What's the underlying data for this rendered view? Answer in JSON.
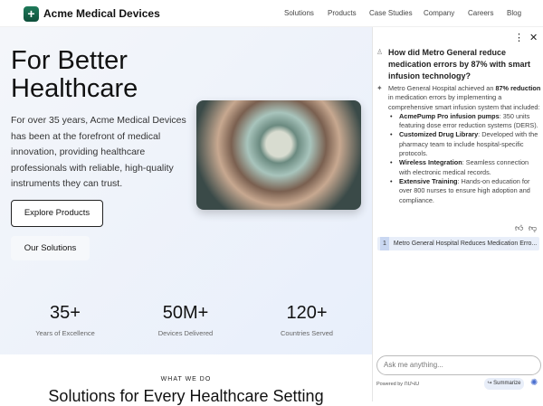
{
  "header": {
    "brand": "Acme Medical Devices",
    "nav": [
      "Solutions",
      "Products",
      "Case Studies",
      "Company",
      "Careers",
      "Blog"
    ]
  },
  "hero": {
    "title_line1": "For Better",
    "title_line2": "Healthcare",
    "lead": "For over 35 years, Acme Medical Devices has been at the forefront of medical innovation, providing healthcare professionals with reliable, high-quality instruments they can trust.",
    "primary_button": "Explore Products",
    "secondary_button": "Our Solutions"
  },
  "stats": [
    {
      "value": "35+",
      "label": "Years of Excellence"
    },
    {
      "value": "50M+",
      "label": "Devices Delivered"
    },
    {
      "value": "120+",
      "label": "Countries Served"
    }
  ],
  "section": {
    "eyebrow": "WHAT WE DO",
    "heading": "Solutions for Every Healthcare Setting"
  },
  "chat": {
    "question": "How did Metro General reduce medication errors by 87% with smart infusion technology?",
    "answer_intro_pre": "Metro General Hospital achieved an ",
    "answer_intro_bold": "87% reduction",
    "answer_intro_post": " in medication errors by implementing a comprehensive smart infusion system that included:",
    "bullets": [
      {
        "title": "AcmePump Pro infusion pumps",
        "text": ": 350 units featuring dose error reduction systems (DERS)."
      },
      {
        "title": "Customized Drug Library",
        "text": ": Developed with the pharmacy team to include hospital-specific protocols."
      },
      {
        "title": "Wireless Integration",
        "text": ": Seamless connection with electronic medical records."
      },
      {
        "title": "Extensive Training",
        "text": ": Hands-on education for over 800 nurses to ensure high adoption and compliance."
      }
    ],
    "source_num": "1",
    "source_title": "Metro General Hospital Reduces Medication Erro...",
    "placeholder": "Ask me anything...",
    "powered_by": "Powered by",
    "powered_brand": "ՈՄՎՍ",
    "summarize": "Summarize"
  }
}
